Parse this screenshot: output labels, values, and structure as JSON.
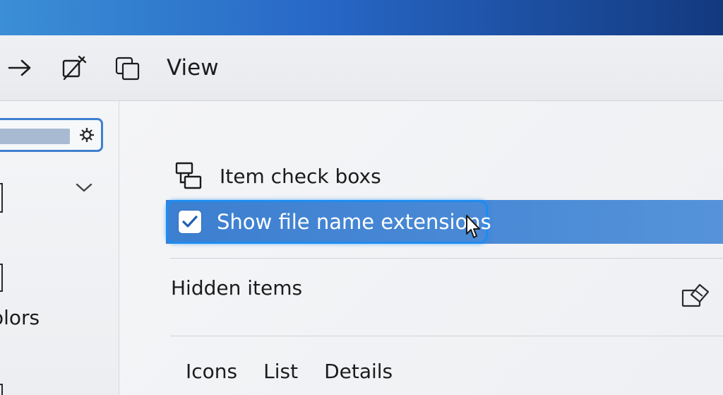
{
  "toolbar": {
    "forward_icon": "arrow-right-icon",
    "rename_icon": "rename-icon",
    "copy_icon": "copy-path-icon",
    "view_label": "View"
  },
  "sidebar": {
    "search_icon": "gear-icon",
    "chevron_icon": "chevron-down-icon",
    "partial_label": "olors"
  },
  "view_menu": {
    "item_check_boxes": {
      "label": "Item check boxs",
      "icon": "item-checkbox-icon"
    },
    "show_extensions": {
      "label": "Show file name extensions",
      "checked": true
    },
    "hidden_items": {
      "label": "Hidden items",
      "icon": "toggle-visibility-icon"
    },
    "layouts": [
      "Icons",
      "List",
      "Details"
    ]
  },
  "colors": {
    "accent": "#3d7fd0",
    "focus_ring": "#1e8cf0",
    "title_bar_start": "#3b8fd6",
    "title_bar_end": "#13397f"
  }
}
